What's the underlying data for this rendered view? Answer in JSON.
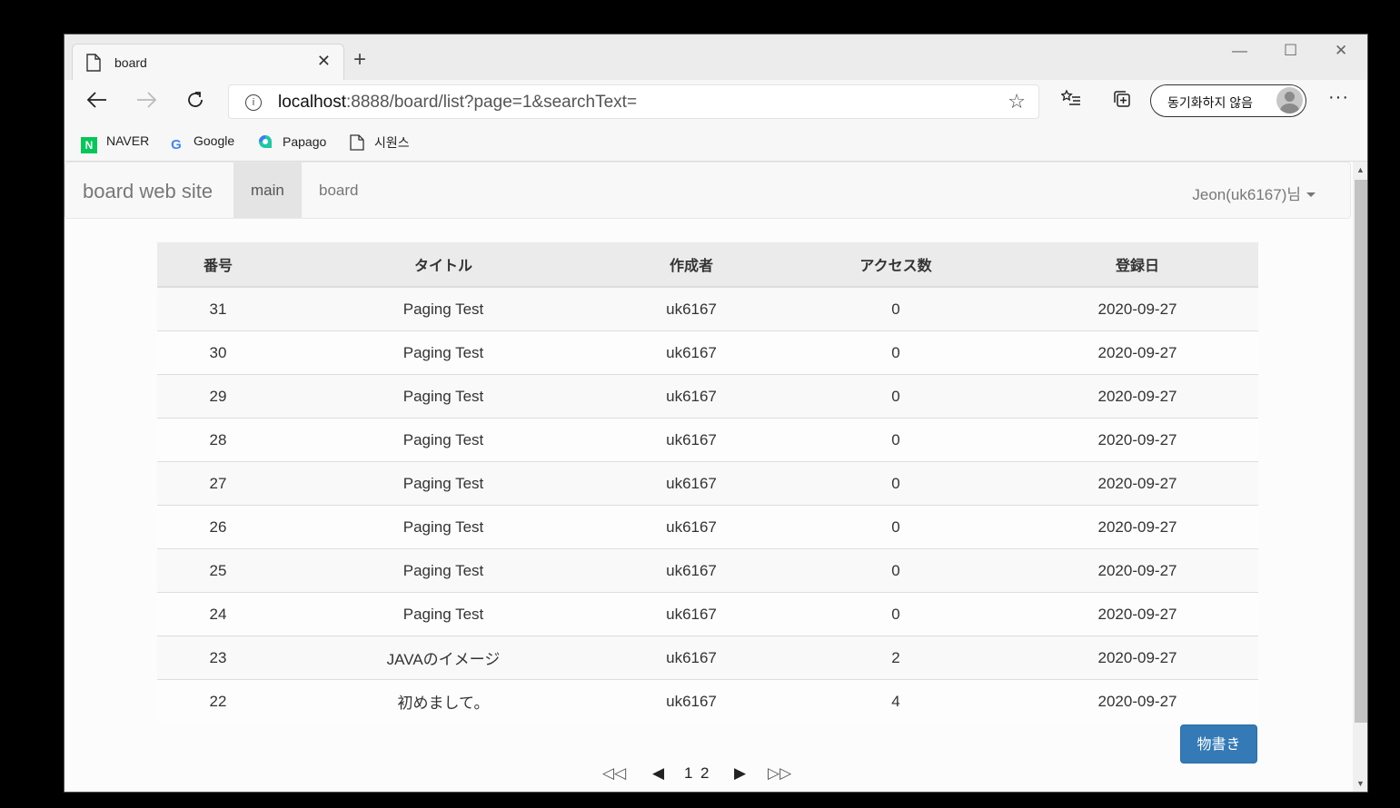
{
  "browser": {
    "tab_title": "board",
    "url_host": "localhost",
    "url_rest": ":8888/board/list?page=1&searchText=",
    "sync_label": "동기화하지 않음",
    "bookmarks": [
      {
        "label": "NAVER",
        "icon": "naver-icon",
        "color": "#03c75a"
      },
      {
        "label": "Google",
        "icon": "google-icon",
        "color": "#4285f4"
      },
      {
        "label": "Papago",
        "icon": "papago-icon",
        "color": "#1ec8a5"
      },
      {
        "label": "시원스",
        "icon": "page-icon",
        "color": "#333333"
      }
    ]
  },
  "navbar": {
    "brand": "board web site",
    "links": [
      "main",
      "board"
    ],
    "active": "main",
    "user": "Jeon(uk6167)님"
  },
  "table": {
    "headers": [
      "番号",
      "タイトル",
      "作成者",
      "アクセス数",
      "登録日"
    ],
    "rows": [
      [
        "31",
        "Paging Test",
        "uk6167",
        "0",
        "2020-09-27"
      ],
      [
        "30",
        "Paging Test",
        "uk6167",
        "0",
        "2020-09-27"
      ],
      [
        "29",
        "Paging Test",
        "uk6167",
        "0",
        "2020-09-27"
      ],
      [
        "28",
        "Paging Test",
        "uk6167",
        "0",
        "2020-09-27"
      ],
      [
        "27",
        "Paging Test",
        "uk6167",
        "0",
        "2020-09-27"
      ],
      [
        "26",
        "Paging Test",
        "uk6167",
        "0",
        "2020-09-27"
      ],
      [
        "25",
        "Paging Test",
        "uk6167",
        "0",
        "2020-09-27"
      ],
      [
        "24",
        "Paging Test",
        "uk6167",
        "0",
        "2020-09-27"
      ],
      [
        "23",
        "JAVAのイメージ",
        "uk6167",
        "2",
        "2020-09-27"
      ],
      [
        "22",
        "初めまして。",
        "uk6167",
        "4",
        "2020-09-27"
      ]
    ]
  },
  "write_button": "物書き",
  "pagination": {
    "first": "◁◁",
    "prev": "◀",
    "pages": [
      "1",
      "2"
    ],
    "next": "▶",
    "last": "▷▷"
  },
  "colors": {
    "accent": "#337ab7"
  }
}
